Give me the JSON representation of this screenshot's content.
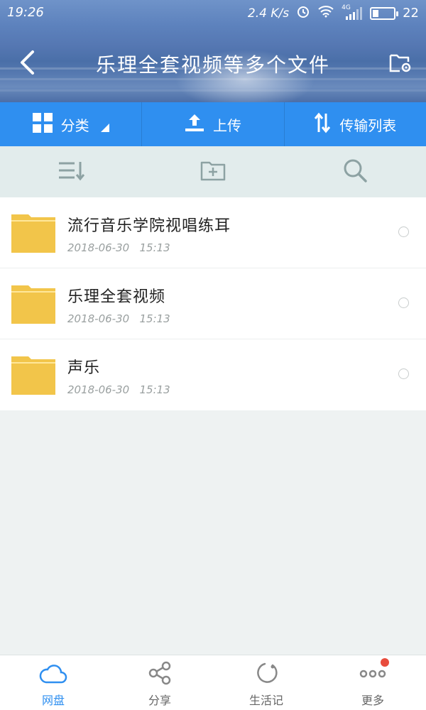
{
  "status": {
    "time": "19:26",
    "speed": "2.4 K/s",
    "network": "4G",
    "battery": "22"
  },
  "header": {
    "title": "乐理全套视频等多个文件"
  },
  "toolbar": {
    "category_label": "分类",
    "upload_label": "上传",
    "transfer_label": "传输列表"
  },
  "files": [
    {
      "name": "流行音乐学院视唱练耳",
      "date": "2018-06-30",
      "time": "15:13"
    },
    {
      "name": "乐理全套视频",
      "date": "2018-06-30",
      "time": "15:13"
    },
    {
      "name": "声乐",
      "date": "2018-06-30",
      "time": "15:13"
    }
  ],
  "nav": {
    "items": [
      {
        "label": "网盘",
        "icon": "cloud-icon",
        "active": true
      },
      {
        "label": "分享",
        "icon": "share-icon",
        "active": false
      },
      {
        "label": "生活记",
        "icon": "circle-refresh-icon",
        "active": false
      },
      {
        "label": "更多",
        "icon": "more-dots-icon",
        "active": false
      }
    ]
  },
  "colors": {
    "accent": "#2f8ff0",
    "folder": "#f2c54a",
    "badge": "#e84c3d"
  }
}
